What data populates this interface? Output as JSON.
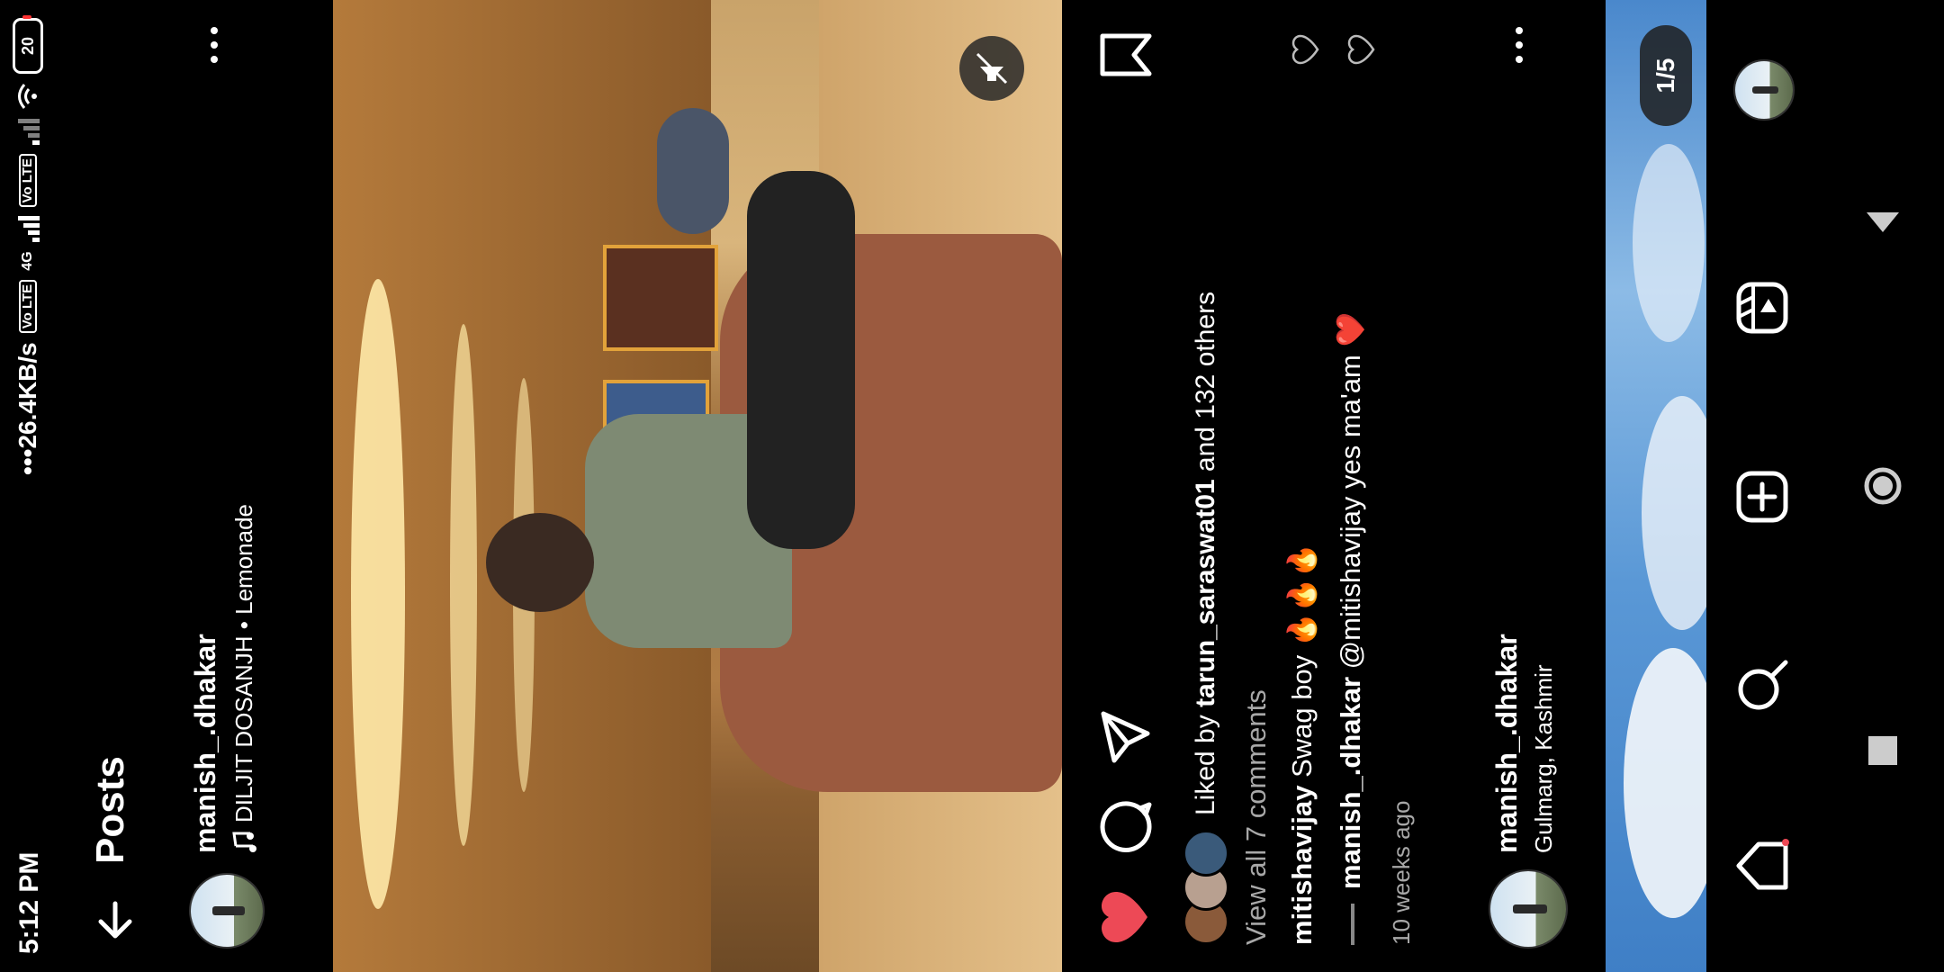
{
  "status_bar": {
    "time": "5:12 PM",
    "speed": "26.4KB/s",
    "network": "4G",
    "volte_1": "Vo LTE",
    "volte_2": "Vo LTE",
    "battery": "20"
  },
  "header": {
    "title": "Posts",
    "back_icon": "arrow-left-icon"
  },
  "post": {
    "username": "manish_.dhakar",
    "audio": "DILJIT DOSANJH • Lemonade",
    "more_icon": "more-horizontal-icon",
    "liked_prefix": "Liked by",
    "liked_user": "tarun_saraswat01",
    "liked_suffix": "and 132 others",
    "view_comments": "View all 7 comments",
    "comments": [
      {
        "user": "mitishavijay",
        "text": "Swag boy 🔥🔥🔥"
      },
      {
        "user": "manish_.dhakar",
        "text": "@mitishavijay yes ma'am ❤️"
      }
    ],
    "time_ago": "10 weeks ago",
    "liked": true
  },
  "next_post": {
    "username": "manish_.dhakar",
    "location": "Gulmarg, Kashmir",
    "counter": "1/5"
  },
  "colors": {
    "like_red": "#ed4956",
    "background": "#000000",
    "muted": "#a8a8a8"
  }
}
